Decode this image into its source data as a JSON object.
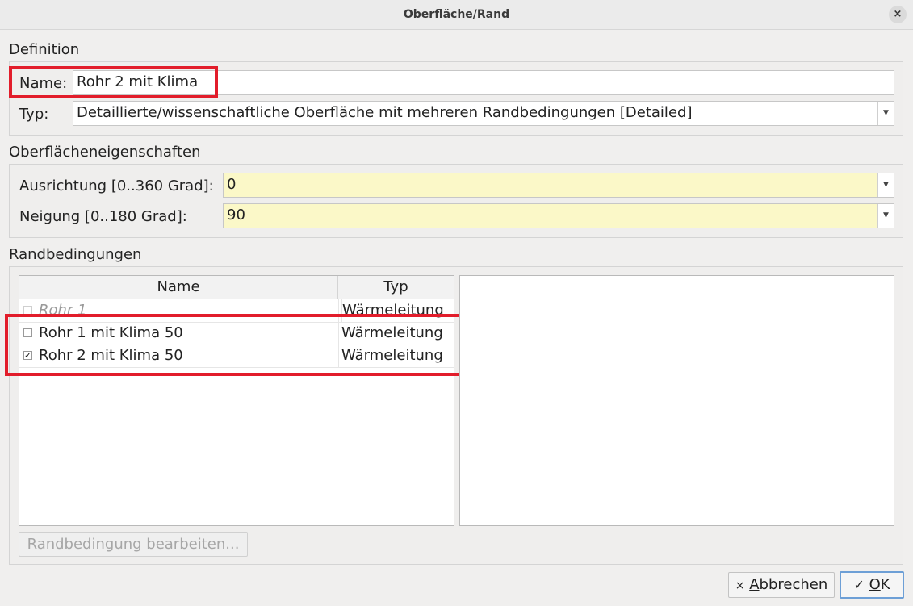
{
  "window": {
    "title": "Oberfläche/Rand",
    "close_glyph": "×"
  },
  "definition": {
    "section_title": "Definition",
    "name_label": "Name:",
    "name_value": "Rohr 2 mit Klima",
    "typ_label": "Typ:",
    "typ_value": "Detaillierte/wissenschaftliche Oberfläche mit mehreren Randbedingungen [Detailed]"
  },
  "properties": {
    "section_title": "Oberflächeneigenschaften",
    "ausrichtung_label": "Ausrichtung [0..360 Grad]:",
    "ausrichtung_value": "0",
    "neigung_label": "Neigung [0..180 Grad]:",
    "neigung_value": "90"
  },
  "boundary": {
    "section_title": "Randbedingungen",
    "columns": [
      "Name",
      "Typ"
    ],
    "rows": [
      {
        "name": "Rohr 1",
        "typ": "Wärmeleitung",
        "checked": false,
        "disabled": true
      },
      {
        "name": "Rohr 1 mit Klima 50",
        "typ": "Wärmeleitung",
        "checked": false,
        "disabled": false
      },
      {
        "name": "Rohr 2 mit Klima 50",
        "typ": "Wärmeleitung",
        "checked": true,
        "disabled": false
      }
    ],
    "edit_button": "Randbedingung bearbeiten..."
  },
  "footer": {
    "cancel_icon": "×",
    "cancel_mnemonic": "A",
    "cancel_rest": "bbrechen",
    "ok_icon": "✓",
    "ok_mnemonic": "O",
    "ok_rest": "K"
  },
  "colors": {
    "highlight": "#e21d2b",
    "edited_field": "#fbf8c8"
  },
  "icons": {
    "close": "close-icon",
    "dropdown": "chevron-down-icon",
    "cancel": "x-icon",
    "ok": "check-icon"
  }
}
